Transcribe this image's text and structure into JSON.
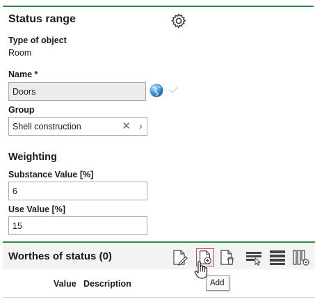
{
  "header": {
    "title": "Status range",
    "settings_icon": "gear-icon"
  },
  "type_of_object": {
    "label": "Type of object",
    "value": "Room"
  },
  "name": {
    "label": "Name *",
    "value": "Doors"
  },
  "group": {
    "label": "Group",
    "value": "Shell construction"
  },
  "weighting": {
    "title": "Weighting",
    "substance": {
      "label": "Substance Value [%]",
      "value": "6"
    },
    "use": {
      "label": "Use Value [%]",
      "value": "15"
    }
  },
  "worthes": {
    "title": "Worthes of status (0)",
    "toolbar": [
      "edit-document-icon",
      "add-document-icon",
      "delete-document-icon",
      "filter-columns-icon",
      "list-view-icon",
      "column-settings-icon"
    ],
    "columns": {
      "value": "Value",
      "description": "Description"
    },
    "tooltip": "Add"
  },
  "colors": {
    "accent_green": "#2e8b47",
    "highlight_red": "#d9413a"
  }
}
